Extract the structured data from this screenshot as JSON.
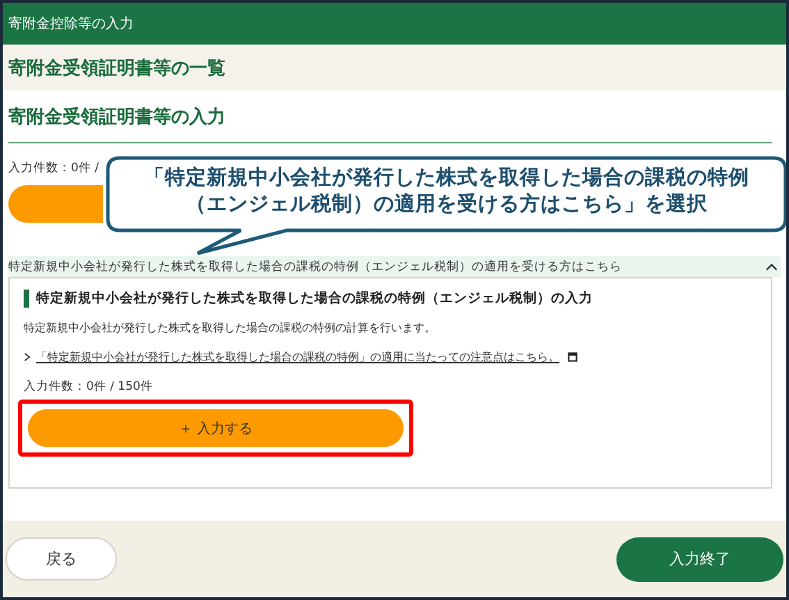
{
  "window": {
    "title": "寄附金控除等の入力"
  },
  "list_section": {
    "heading": "寄附金受領証明書等の一覧"
  },
  "input_section": {
    "heading": "寄附金受領証明書等の入力",
    "count": "入力件数：0件 /"
  },
  "callout": {
    "lines": [
      "「特定新規中小会社が発行した株式を取得した場合の課税の特例",
      "（エンジェル税制）の適用を受ける方はこちら」を選択"
    ]
  },
  "accordion": {
    "title": "特定新規中小会社が発行した株式を取得した場合の課税の特例（エンジェル税制）の適用を受ける方はこちら",
    "expanded": true,
    "panel": {
      "heading": "特定新規中小会社が発行した株式を取得した場合の課税の特例（エンジェル税制）の入力",
      "description": "特定新規中小会社が発行した株式を取得した場合の課税の特例の計算を行います。",
      "link": "「特定新規中小会社が発行した株式を取得した場合の課税の特例」の適用に当たっての注意点はこちら。",
      "count": "入力件数：0件 / 150件",
      "add_button": "＋ 入力する",
      "highlighted": true
    }
  },
  "footer": {
    "back": "戻る",
    "finish": "入力終了"
  }
}
